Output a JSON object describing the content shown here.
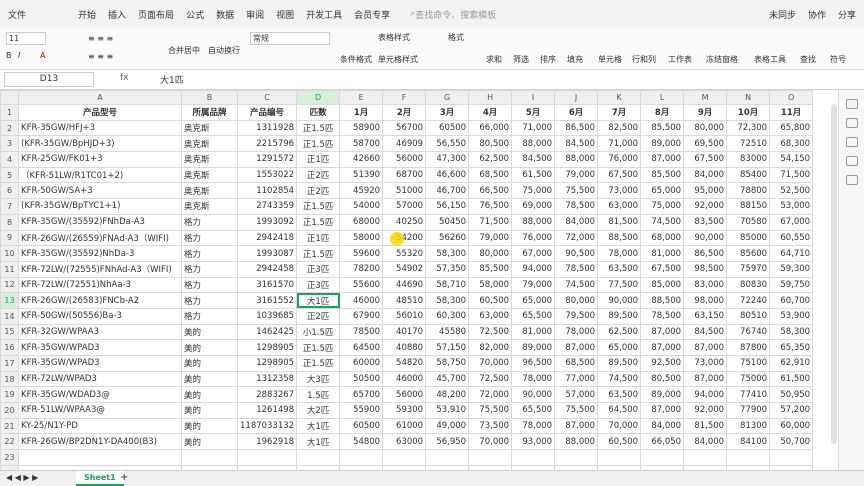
{
  "menu": {
    "file": "文件",
    "tabs": [
      "开始",
      "插入",
      "页面布局",
      "公式",
      "数据",
      "审阅",
      "视图",
      "开发工具",
      "会员专享"
    ],
    "search": "查找命令、搜索模板",
    "sync": "未同步",
    "collab": "协作",
    "share": "分享"
  },
  "ribbon": {
    "font_size": "11",
    "merge": "合并居中",
    "wrap": "自动换行",
    "format": "常规",
    "cond": "条件格式",
    "table_style": "表格样式",
    "cell_style": "单元格样式",
    "style": "格式",
    "sum": "求和",
    "filter": "筛选",
    "sort": "排序",
    "fill": "填充",
    "cell": "单元格",
    "rowcol": "行和列",
    "sheet": "工作表",
    "freeze": "冻结窗格",
    "tools": "表格工具",
    "find": "查找",
    "symbol": "符号"
  },
  "formula_bar": {
    "cell": "D13",
    "fx": "fx",
    "value": "大1匹"
  },
  "columns": [
    "A",
    "B",
    "C",
    "D",
    "E",
    "F",
    "G",
    "H",
    "I",
    "J",
    "K",
    "L",
    "M",
    "N",
    "O"
  ],
  "headers": [
    "产品型号",
    "所属品牌",
    "产品编号",
    "匹数",
    "1月",
    "2月",
    "3月",
    "4月",
    "5月",
    "6月",
    "7月",
    "8月",
    "9月",
    "10月",
    "11月"
  ],
  "rows": [
    [
      "KFR-35GW/HFJ+3",
      "奥克斯",
      "1311928",
      "正1.5匹",
      "58900",
      "56700",
      "60500",
      "66,000",
      "71,000",
      "86,500",
      "82,500",
      "85,500",
      "80,000",
      "72,300",
      "65,800"
    ],
    [
      "(KFR-35GW/BpHJD+3)",
      "奥克斯",
      "2215796",
      "正1.5匹",
      "58700",
      "46909",
      "56,550",
      "80,500",
      "88,000",
      "84,500",
      "71,000",
      "89,000",
      "69,500",
      "72510",
      "68,300"
    ],
    [
      "KFR-25GW/FK01+3",
      "奥克斯",
      "1291572",
      "正1匹",
      "42660",
      "56000",
      "47,300",
      "62,500",
      "84,500",
      "88,000",
      "76,000",
      "87,000",
      "67,500",
      "83000",
      "54,150"
    ],
    [
      "（KFR-51LW/R1TC01+2)",
      "奥克斯",
      "1553022",
      "正2匹",
      "51390",
      "68700",
      "46,600",
      "68,500",
      "61,500",
      "79,000",
      "67,500",
      "85,500",
      "84,000",
      "85400",
      "71,500"
    ],
    [
      "KFR-50GW/SA+3",
      "奥克斯",
      "1102854",
      "正2匹",
      "45920",
      "51000",
      "46,700",
      "66,500",
      "75,000",
      "75,500",
      "73,000",
      "65,000",
      "95,000",
      "78800",
      "52,500"
    ],
    [
      "(KFR-35GW/BpTYC1+1)",
      "奥克斯",
      "2743359",
      "正1.5匹",
      "54000",
      "57000",
      "56,150",
      "76,500",
      "69,000",
      "78,500",
      "63,000",
      "75,000",
      "92,000",
      "88150",
      "53,000"
    ],
    [
      "KFR-35GW/(35592)FNhDa-A3",
      "格力",
      "1993092",
      "正1.5匹",
      "68000",
      "40250",
      "50450",
      "71,500",
      "88,000",
      "84,000",
      "81,500",
      "74,500",
      "83,500",
      "70580",
      "67,000"
    ],
    [
      "KFR-26GW/(26559)FNAd-A3（WIFI)",
      "格力",
      "2942418",
      "正1匹",
      "58000",
      "54200",
      "56260",
      "79,000",
      "76,000",
      "72,000",
      "88,500",
      "68,000",
      "90,000",
      "85000",
      "60,550"
    ],
    [
      "KFR-35GW/(35592)NhDa-3",
      "格力",
      "1993087",
      "正1.5匹",
      "59600",
      "55320",
      "58,300",
      "80,000",
      "67,000",
      "90,500",
      "78,000",
      "81,000",
      "86,500",
      "85600",
      "64,710"
    ],
    [
      "KFR-72LW/(72555)FNhAd-A3（WIFI)",
      "格力",
      "2942458",
      "正3匹",
      "78200",
      "54902",
      "57,350",
      "85,500",
      "94,000",
      "78,500",
      "63,500",
      "67,500",
      "98,500",
      "75970",
      "59,300"
    ],
    [
      "KFR-72LW/(72551)NhAa-3",
      "格力",
      "3161570",
      "正3匹",
      "55600",
      "44690",
      "58,710",
      "58,000",
      "79,000",
      "74,500",
      "77,500",
      "85,000",
      "83,000",
      "80830",
      "59,750"
    ],
    [
      "KFR-26GW/(26583)FNCb-A2",
      "格力",
      "3161552",
      "大1匹",
      "46000",
      "48510",
      "58,300",
      "60,500",
      "65,000",
      "80,000",
      "90,000",
      "88,500",
      "98,000",
      "72240",
      "60,700"
    ],
    [
      "KFR-50GW/(50556)Ba-3",
      "格力",
      "1039685",
      "正2匹",
      "67900",
      "56010",
      "60,300",
      "63,000",
      "65,500",
      "79,500",
      "89,500",
      "78,500",
      "63,150",
      "80510",
      "53,900"
    ],
    [
      "KFR-32GW/WPAA3",
      "美的",
      "1462425",
      "小1.5匹",
      "78500",
      "40170",
      "45580",
      "72,500",
      "81,000",
      "78,000",
      "62,500",
      "87,000",
      "84,500",
      "76740",
      "58,300"
    ],
    [
      "KFR-35GW/WPAD3",
      "美的",
      "1298905",
      "正1.5匹",
      "64500",
      "40880",
      "57,150",
      "82,000",
      "89,000",
      "87,000",
      "65,000",
      "87,000",
      "87,000",
      "87800",
      "65,350"
    ],
    [
      "KFR-35GW/WPAD3",
      "美的",
      "1298905",
      "正1.5匹",
      "60000",
      "54820",
      "58,750",
      "70,000",
      "96,500",
      "68,500",
      "89,500",
      "92,500",
      "73,000",
      "75100",
      "62,910"
    ],
    [
      "KFR-72LW/WPAD3",
      "美的",
      "1312358",
      "大3匹",
      "50500",
      "46000",
      "45,700",
      "72,500",
      "78,000",
      "77,000",
      "74,500",
      "80,500",
      "87,000",
      "75000",
      "61,500"
    ],
    [
      "KFR-35GW/WDAD3@",
      "美的",
      "2883267",
      "1.5匹",
      "65700",
      "56000",
      "48,200",
      "72,000",
      "90,000",
      "57,000",
      "63,500",
      "89,000",
      "94,000",
      "77410",
      "50,950"
    ],
    [
      "KFR-51LW/WPAA3@",
      "美的",
      "1261498",
      "大2匹",
      "55900",
      "59300",
      "53,910",
      "75,500",
      "65,500",
      "75,500",
      "64,500",
      "87,000",
      "92,000",
      "77900",
      "57,200"
    ],
    [
      "KY-25/N1Y-PD",
      "美的",
      "1187033132",
      "大1匹",
      "60500",
      "61000",
      "49,000",
      "73,500",
      "78,000",
      "87,000",
      "70,000",
      "84,000",
      "81,500",
      "81300",
      "60,000"
    ],
    [
      "KFR-26GW/BP2DN1Y-DA400(B3)",
      "美的",
      "1962918",
      "大1匹",
      "54800",
      "63000",
      "56,950",
      "70,000",
      "93,000",
      "88,000",
      "60,500",
      "66,050",
      "84,000",
      "84100",
      "50,700"
    ]
  ],
  "sheet_tab": "Sheet1"
}
